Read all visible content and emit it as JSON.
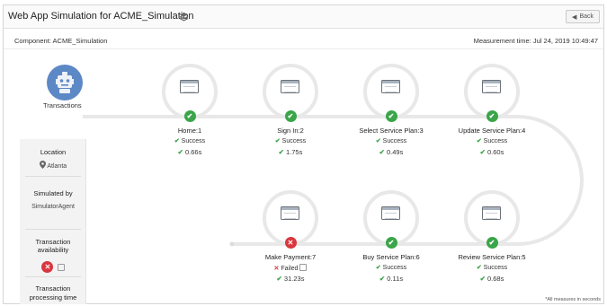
{
  "header": {
    "title": "Web App Simulation for ACME_Simulation",
    "title_icon": "stack-icon",
    "back_label": "Back"
  },
  "subheader": {
    "component": "Component: ACME_Simulation",
    "measurement_time": "Measurement time: Jul 24, 2019 10:49:47"
  },
  "robot": {
    "label": "Transactions",
    "icon": "robot-icon",
    "color": "#5d88c6"
  },
  "side_panel": {
    "location_label": "Location",
    "location_value": "Atlanta",
    "simulated_by_label": "Simulated by",
    "simulated_by_value": "SimulatorAgent",
    "availability_label_1": "Transaction",
    "availability_label_2": "availability",
    "processing_label_1": "Transaction",
    "processing_label_2": "processing time"
  },
  "transactions": [
    {
      "name": "Home:1",
      "status": "Success",
      "time": "0.66s",
      "ok": true
    },
    {
      "name": "Sign In:2",
      "status": "Success",
      "time": "1.75s",
      "ok": true
    },
    {
      "name": "Select Service Plan:3",
      "status": "Success",
      "time": "0.49s",
      "ok": true
    },
    {
      "name": "Update Service Plan:4",
      "status": "Success",
      "time": "0.60s",
      "ok": true
    },
    {
      "name": "Review Service Plan:5",
      "status": "Success",
      "time": "0.68s",
      "ok": true
    },
    {
      "name": "Buy Service Plan:6",
      "status": "Success",
      "time": "0.11s",
      "ok": true
    },
    {
      "name": "Make Payment:7",
      "status": "Failed",
      "time": "31.23s",
      "ok": false
    }
  ],
  "footnote": "*All measures in seconds",
  "colors": {
    "success": "#3aa549",
    "failed": "#d9363e",
    "path": "#e8e8e8"
  }
}
